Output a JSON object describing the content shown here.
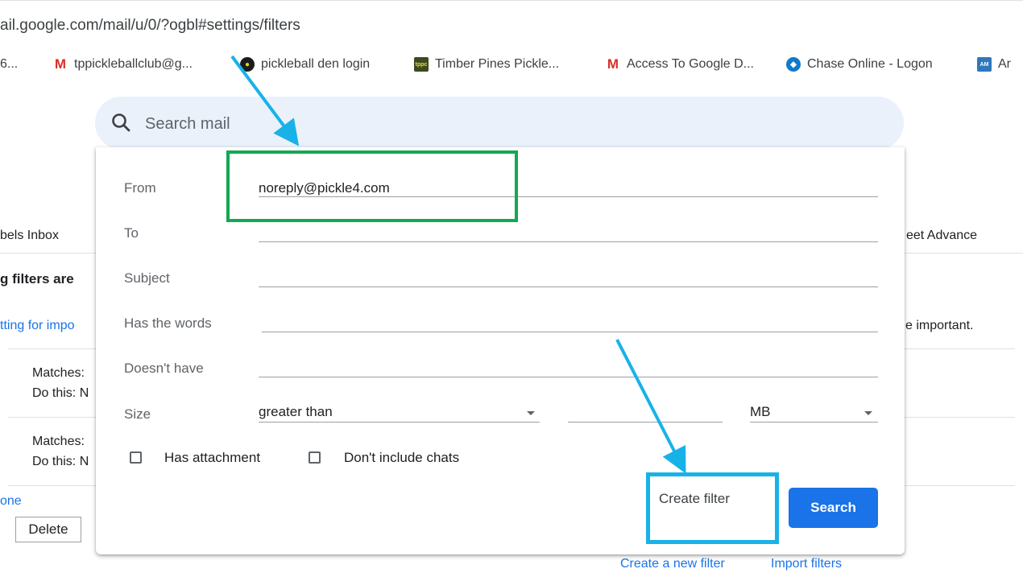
{
  "browser": {
    "url": "ail.google.com/mail/u/0/?ogbl#settings/filters",
    "bookmarks": [
      {
        "icon": "truncated-bookmark",
        "label": "6..."
      },
      {
        "icon": "gmail-icon",
        "label": "tppickleballclub@g..."
      },
      {
        "icon": "pickleball-den-icon",
        "label": "pickleball den login"
      },
      {
        "icon": "tppc-icon",
        "label": "Timber Pines Pickle..."
      },
      {
        "icon": "gmail-icon",
        "label": "Access To Google D..."
      },
      {
        "icon": "chase-icon",
        "label": "Chase Online - Logon"
      },
      {
        "icon": "amex-icon",
        "label": "Ar"
      }
    ]
  },
  "search": {
    "placeholder": "Search mail"
  },
  "background": {
    "tabs_left": "bels  Inbox",
    "tabs_right": "eet  Advance",
    "heading_fragment": "g filters are",
    "link_fragment": "tting for impo",
    "text_fragment_right": "e important.",
    "rows": [
      {
        "matches": "Matches:",
        "action": "Do this: N"
      },
      {
        "matches": "Matches:",
        "action": "Do this: N"
      }
    ],
    "select_link": "one",
    "delete_label": "Delete"
  },
  "filter_dialog": {
    "fields": [
      {
        "label": "From",
        "value": "noreply@pickle4.com"
      },
      {
        "label": "To",
        "value": ""
      },
      {
        "label": "Subject",
        "value": ""
      },
      {
        "label": "Has the words",
        "value": ""
      },
      {
        "label": "Doesn't have",
        "value": ""
      }
    ],
    "size": {
      "label": "Size",
      "operator": "greater than",
      "amount": "",
      "unit": "MB"
    },
    "checkboxes": {
      "has_attachment": "Has attachment",
      "dont_include_chats": "Don't include chats"
    },
    "create_filter_label": "Create filter",
    "search_label": "Search"
  },
  "footer": {
    "create_new_filter": "Create a new filter",
    "import_filters": "Import filters"
  },
  "colors": {
    "primary_blue": "#1a73e8",
    "search_bg": "#eaf1fb",
    "annotation_green": "#12a952",
    "annotation_blue": "#18b2e8"
  }
}
